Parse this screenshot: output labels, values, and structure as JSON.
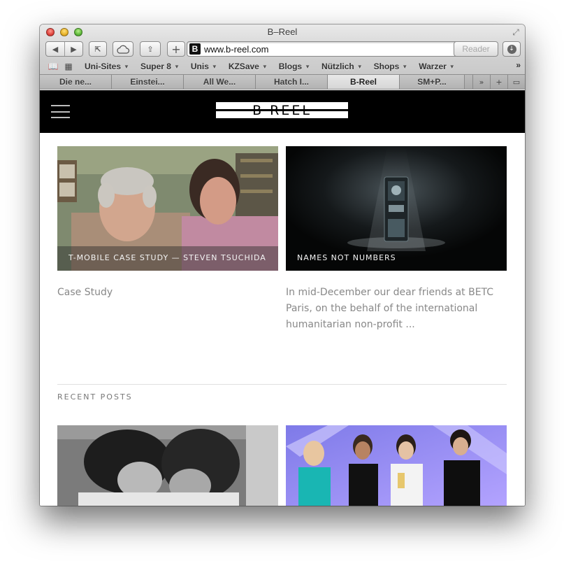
{
  "window": {
    "title": "B–Reel"
  },
  "toolbar": {
    "url": "www.b-reel.com",
    "reader_label": "Reader"
  },
  "bookmarks": {
    "items": [
      {
        "label": "Uni-Sites"
      },
      {
        "label": "Super 8"
      },
      {
        "label": "Unis"
      },
      {
        "label": "KZSave"
      },
      {
        "label": "Blogs"
      },
      {
        "label": "Nützlich"
      },
      {
        "label": "Shops"
      },
      {
        "label": "Warzer"
      }
    ]
  },
  "tabs": {
    "items": [
      {
        "label": "Die ne..."
      },
      {
        "label": "Einstei..."
      },
      {
        "label": "All We..."
      },
      {
        "label": "Hatch I..."
      },
      {
        "label": "B-Reel"
      },
      {
        "label": "SM+P..."
      }
    ],
    "active_index": 4
  },
  "site": {
    "logo_text": "B REEL"
  },
  "cards": [
    {
      "caption": "T-MOBILE CASE STUDY — STEVEN TSUCHIDA",
      "text": "Case Study"
    },
    {
      "caption": "NAMES NOT NUMBERS",
      "text": "In mid-December our dear friends at BETC Paris, on the behalf of the international humanitarian non-profit ..."
    }
  ],
  "recent_posts": {
    "label": "RECENT POSTS"
  },
  "colors": {
    "header_bg": "#000000",
    "text_muted": "#888888",
    "post_bg_purple": "#8a7fe6"
  }
}
